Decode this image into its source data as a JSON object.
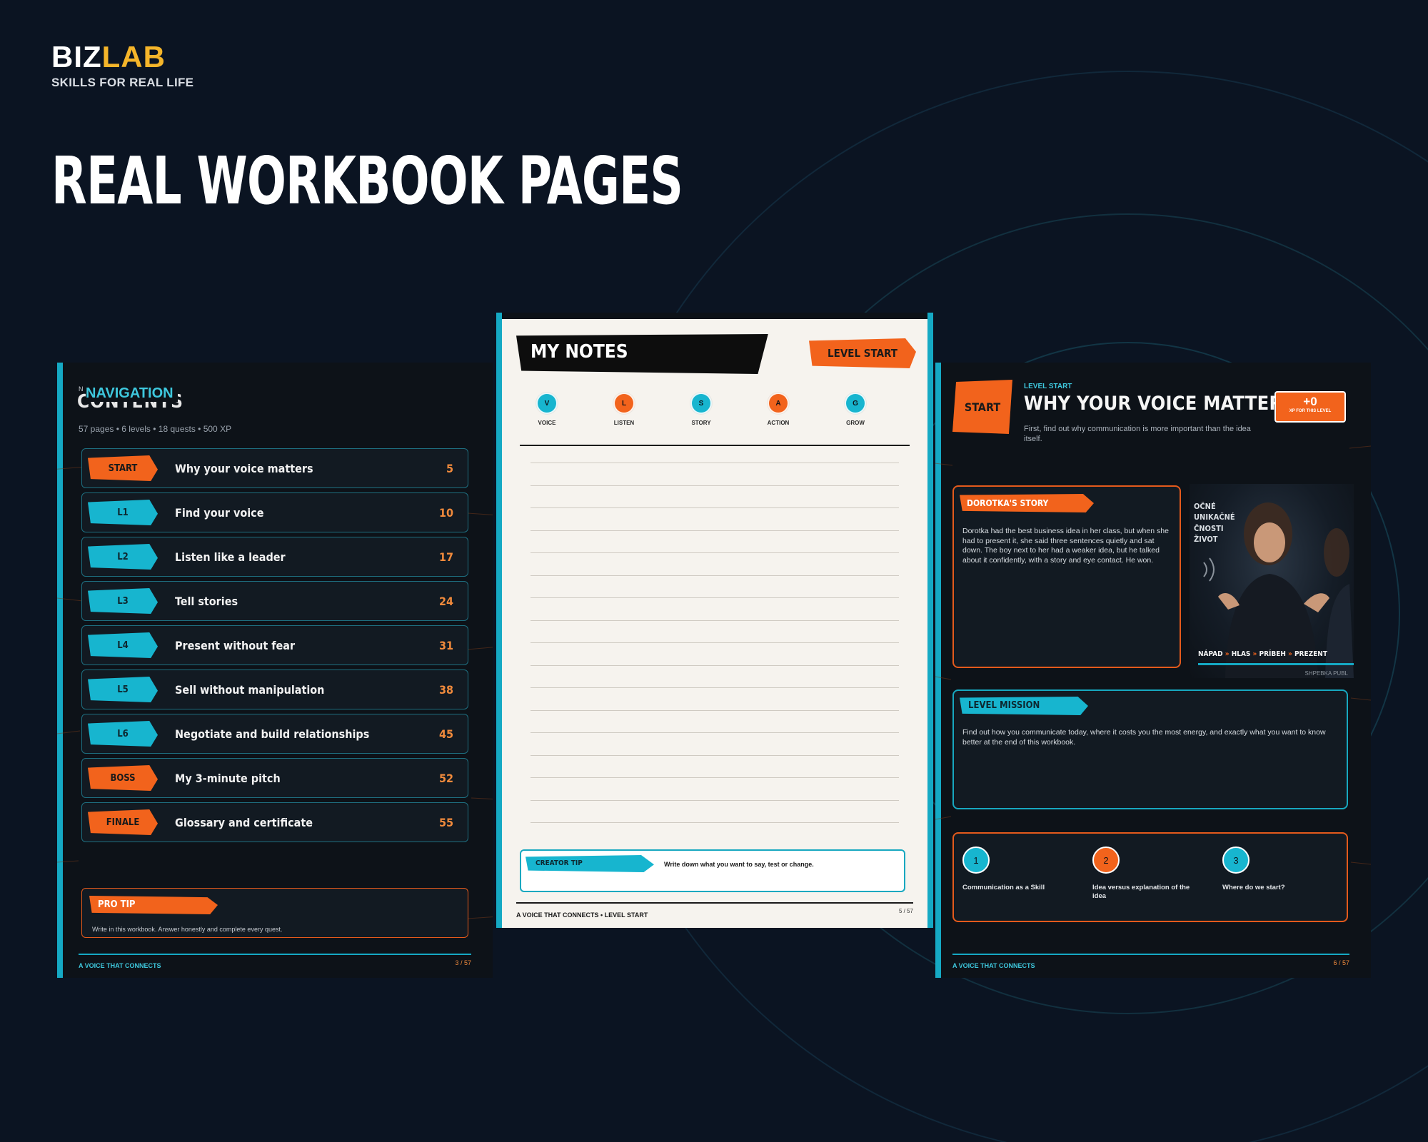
{
  "brand": {
    "name_part1": "BIZ",
    "name_part2": "LAB",
    "tagline": "SKILLS FOR REAL LIFE"
  },
  "hero": {
    "title": "REAL WORKBOOK PAGES"
  },
  "colors": {
    "background": "#0b1422",
    "orange": "#f2631c",
    "cyan": "#17b5cf",
    "gold": "#f5b52a"
  },
  "left_page": {
    "ghost_prefix": "N",
    "ghost_heading": "CONTENTS",
    "heading": "NAVIGATION",
    "subtitle": "57 pages • 6 levels • 18 quests • 500 XP",
    "rows": [
      {
        "tag": "START",
        "label": "Why your voice matters",
        "page": "5",
        "color": "orange"
      },
      {
        "tag": "L1",
        "label": "Find your voice",
        "page": "10",
        "color": "cyan"
      },
      {
        "tag": "L2",
        "label": "Listen like a leader",
        "page": "17",
        "color": "cyan"
      },
      {
        "tag": "L3",
        "label": "Tell stories",
        "page": "24",
        "color": "cyan"
      },
      {
        "tag": "L4",
        "label": "Present without fear",
        "page": "31",
        "color": "cyan"
      },
      {
        "tag": "L5",
        "label": "Sell without manipulation",
        "page": "38",
        "color": "cyan"
      },
      {
        "tag": "L6",
        "label": "Negotiate and build relationships",
        "page": "45",
        "color": "cyan"
      },
      {
        "tag": "BOSS",
        "label": "My 3-minute pitch",
        "page": "52",
        "color": "orange"
      },
      {
        "tag": "FINALE",
        "label": "Glossary and certificate",
        "page": "55",
        "color": "orange"
      }
    ],
    "pro_tip": {
      "tag": "PRO TIP",
      "text": "Write in this workbook. Answer honestly and complete every quest."
    },
    "footer_left": "A VOICE THAT CONNECTS",
    "footer_right": "3 / 57"
  },
  "center_page": {
    "header": "MY NOTES",
    "level_tag": "LEVEL START",
    "steps": [
      {
        "letter": "V",
        "label": "VOICE",
        "color": "cyan"
      },
      {
        "letter": "L",
        "label": "LISTEN",
        "color": "orange"
      },
      {
        "letter": "S",
        "label": "STORY",
        "color": "cyan"
      },
      {
        "letter": "A",
        "label": "ACTION",
        "color": "orange"
      },
      {
        "letter": "G",
        "label": "GROW",
        "color": "cyan"
      }
    ],
    "line_count": 17,
    "creator_tip": {
      "tag": "CREATOR TIP",
      "text": "Write down what you want to say, test or change."
    },
    "footer_left": "A VOICE THAT CONNECTS • LEVEL START",
    "footer_right": "5 / 57"
  },
  "right_page": {
    "start_tag": "START",
    "kicker": "LEVEL START",
    "title": "WHY YOUR VOICE MATTERS",
    "subtitle": "First, find out why communication is more important than the idea itself.",
    "xp": {
      "value": "+0",
      "label": "XP FOR THIS LEVEL"
    },
    "story": {
      "tag": "DOROTKA'S STORY",
      "text": "Dorotka had the best business idea in her class, but when she had to present it, she said three sentences quietly and sat down. The boy next to her had a weaker idea, but he talked about it confidently, with a story and eye contact. He won."
    },
    "photo": {
      "side_words": [
        "OČNÉ",
        "UNIKAČNÉ",
        "ČNOSTI",
        "ŽIVOT"
      ],
      "bottom_words": [
        "NÁPAD",
        "HLAS",
        "PRÍBEH",
        "PREZENT"
      ],
      "separator": "»",
      "footer": "SHPEBKA PUBL"
    },
    "mission": {
      "tag": "LEVEL MISSION",
      "text": "Find out how you communicate today, where it costs you the most energy, and exactly what you want to know better at the end of this workbook."
    },
    "steps": [
      {
        "num": "1",
        "label": "Communication as a Skill",
        "color": "cyan"
      },
      {
        "num": "2",
        "label": "Idea versus explanation of the idea",
        "color": "orange"
      },
      {
        "num": "3",
        "label": "Where do we start?",
        "color": "cyan"
      }
    ],
    "footer_left": "A VOICE THAT CONNECTS",
    "footer_right": "6 / 57"
  }
}
